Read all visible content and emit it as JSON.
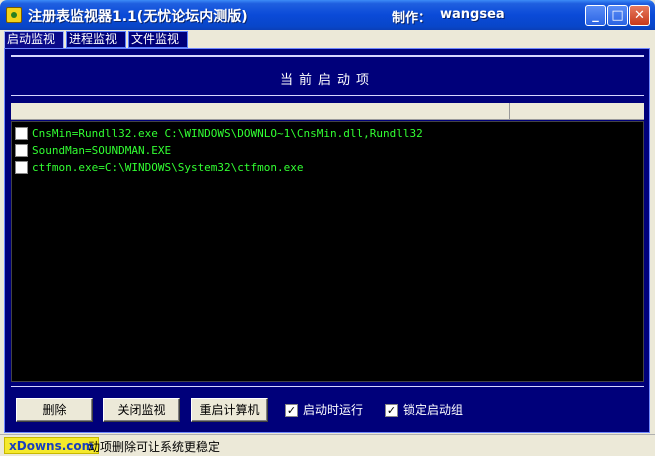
{
  "window": {
    "title": "注册表监视器1.1(无忧论坛内测版)",
    "author_label": "制作：",
    "author": "wangsea",
    "controls": {
      "minimize": "_",
      "maximize": "□",
      "close": "✕"
    }
  },
  "tabs": [
    {
      "label": "启动监视",
      "active": true
    },
    {
      "label": "进程监视",
      "active": false
    },
    {
      "label": "文件监视",
      "active": false
    }
  ],
  "panel": {
    "header_title": "当前启动项",
    "items": [
      {
        "text": "CnsMin=Rundll32.exe C:\\WINDOWS\\DOWNLO~1\\CnsMin.dll,Rundll32",
        "checked": false
      },
      {
        "text": "SoundMan=SOUNDMAN.EXE",
        "checked": false
      },
      {
        "text": "ctfmon.exe=C:\\WINDOWS\\System32\\ctfmon.exe",
        "checked": false
      }
    ]
  },
  "controls": {
    "delete_label": "删除",
    "stop_monitor_label": "关闭监视",
    "restart_label": "重启计算机",
    "checkbox_run_on_start": {
      "label": "启动时运行",
      "checked": true,
      "mark": "✓"
    },
    "checkbox_lock_group": {
      "label": "锁定启动组",
      "checked": true,
      "mark": "✓"
    }
  },
  "statusbar": {
    "watermark": "xDowns.com",
    "text": "动项删除可让系统更稳定"
  },
  "colors": {
    "title_bar": "#0a4ad8",
    "panel_bg": "#00007a",
    "list_bg": "#000000",
    "list_text": "#32ff32",
    "watermark_bg": "#f5e92b"
  }
}
